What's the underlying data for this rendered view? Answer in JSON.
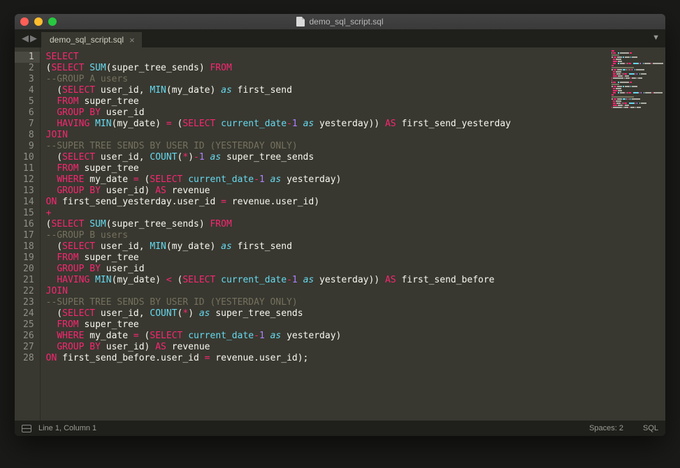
{
  "window_title": "demo_sql_script.sql",
  "tab": {
    "label": "demo_sql_script.sql"
  },
  "status": {
    "position": "Line 1, Column 1",
    "spaces": "Spaces: 2",
    "syntax": "SQL"
  },
  "lines": [
    {
      "n": 1,
      "tokens": [
        [
          "kw",
          "SELECT"
        ]
      ]
    },
    {
      "n": 2,
      "tokens": [
        [
          "ident",
          "("
        ],
        [
          "kw",
          "SELECT"
        ],
        [
          "ident",
          " "
        ],
        [
          "fn",
          "SUM"
        ],
        [
          "ident",
          "(super_tree_sends) "
        ],
        [
          "kw",
          "FROM"
        ]
      ]
    },
    {
      "n": 3,
      "tokens": [
        [
          "cm",
          "--GROUP A users"
        ]
      ]
    },
    {
      "n": 4,
      "tokens": [
        [
          "ident",
          "  ("
        ],
        [
          "kw",
          "SELECT"
        ],
        [
          "ident",
          " user_id, "
        ],
        [
          "fn",
          "MIN"
        ],
        [
          "ident",
          "(my_date) "
        ],
        [
          "as",
          "as"
        ],
        [
          "ident",
          " first_send"
        ]
      ]
    },
    {
      "n": 5,
      "tokens": [
        [
          "ident",
          "  "
        ],
        [
          "kw",
          "FROM"
        ],
        [
          "ident",
          " super_tree"
        ]
      ]
    },
    {
      "n": 6,
      "tokens": [
        [
          "ident",
          "  "
        ],
        [
          "kw",
          "GROUP BY"
        ],
        [
          "ident",
          " user_id"
        ]
      ]
    },
    {
      "n": 7,
      "tokens": [
        [
          "ident",
          "  "
        ],
        [
          "kw",
          "HAVING"
        ],
        [
          "ident",
          " "
        ],
        [
          "fn",
          "MIN"
        ],
        [
          "ident",
          "(my_date) "
        ],
        [
          "op",
          "="
        ],
        [
          "ident",
          " ("
        ],
        [
          "kw",
          "SELECT"
        ],
        [
          "ident",
          " "
        ],
        [
          "fn",
          "current_date"
        ],
        [
          "op",
          "-"
        ],
        [
          "num",
          "1"
        ],
        [
          "ident",
          " "
        ],
        [
          "as",
          "as"
        ],
        [
          "ident",
          " yesterday)) "
        ],
        [
          "kw",
          "AS"
        ],
        [
          "ident",
          " first_send_yesterday"
        ]
      ]
    },
    {
      "n": 8,
      "tokens": [
        [
          "kw",
          "JOIN"
        ]
      ]
    },
    {
      "n": 9,
      "tokens": [
        [
          "cm",
          "--SUPER TREE SENDS BY USER ID (YESTERDAY ONLY)"
        ]
      ]
    },
    {
      "n": 10,
      "tokens": [
        [
          "ident",
          "  ("
        ],
        [
          "kw",
          "SELECT"
        ],
        [
          "ident",
          " user_id, "
        ],
        [
          "fn",
          "COUNT"
        ],
        [
          "ident",
          "("
        ],
        [
          "op",
          "*"
        ],
        [
          "ident",
          ")"
        ],
        [
          "op",
          "-"
        ],
        [
          "num",
          "1"
        ],
        [
          "ident",
          " "
        ],
        [
          "as",
          "as"
        ],
        [
          "ident",
          " super_tree_sends"
        ]
      ]
    },
    {
      "n": 11,
      "tokens": [
        [
          "ident",
          "  "
        ],
        [
          "kw",
          "FROM"
        ],
        [
          "ident",
          " super_tree"
        ]
      ]
    },
    {
      "n": 12,
      "tokens": [
        [
          "ident",
          "  "
        ],
        [
          "kw",
          "WHERE"
        ],
        [
          "ident",
          " my_date "
        ],
        [
          "op",
          "="
        ],
        [
          "ident",
          " ("
        ],
        [
          "kw",
          "SELECT"
        ],
        [
          "ident",
          " "
        ],
        [
          "fn",
          "current_date"
        ],
        [
          "op",
          "-"
        ],
        [
          "num",
          "1"
        ],
        [
          "ident",
          " "
        ],
        [
          "as",
          "as"
        ],
        [
          "ident",
          " yesterday)"
        ]
      ]
    },
    {
      "n": 13,
      "tokens": [
        [
          "ident",
          "  "
        ],
        [
          "kw",
          "GROUP BY"
        ],
        [
          "ident",
          " user_id) "
        ],
        [
          "kw",
          "AS"
        ],
        [
          "ident",
          " revenue"
        ]
      ]
    },
    {
      "n": 14,
      "tokens": [
        [
          "kw",
          "ON"
        ],
        [
          "ident",
          " first_send_yesterday"
        ],
        [
          "ident",
          "."
        ],
        [
          "ident",
          "user_id "
        ],
        [
          "op",
          "="
        ],
        [
          "ident",
          " revenue"
        ],
        [
          "ident",
          "."
        ],
        [
          "ident",
          "user_id)"
        ]
      ]
    },
    {
      "n": 15,
      "tokens": [
        [
          "op",
          "+"
        ]
      ]
    },
    {
      "n": 16,
      "tokens": [
        [
          "ident",
          "("
        ],
        [
          "kw",
          "SELECT"
        ],
        [
          "ident",
          " "
        ],
        [
          "fn",
          "SUM"
        ],
        [
          "ident",
          "(super_tree_sends) "
        ],
        [
          "kw",
          "FROM"
        ]
      ]
    },
    {
      "n": 17,
      "tokens": [
        [
          "cm",
          "--GROUP B users"
        ]
      ]
    },
    {
      "n": 18,
      "tokens": [
        [
          "ident",
          "  ("
        ],
        [
          "kw",
          "SELECT"
        ],
        [
          "ident",
          " user_id, "
        ],
        [
          "fn",
          "MIN"
        ],
        [
          "ident",
          "(my_date) "
        ],
        [
          "as",
          "as"
        ],
        [
          "ident",
          " first_send"
        ]
      ]
    },
    {
      "n": 19,
      "tokens": [
        [
          "ident",
          "  "
        ],
        [
          "kw",
          "FROM"
        ],
        [
          "ident",
          " super_tree"
        ]
      ]
    },
    {
      "n": 20,
      "tokens": [
        [
          "ident",
          "  "
        ],
        [
          "kw",
          "GROUP BY"
        ],
        [
          "ident",
          " user_id"
        ]
      ]
    },
    {
      "n": 21,
      "tokens": [
        [
          "ident",
          "  "
        ],
        [
          "kw",
          "HAVING"
        ],
        [
          "ident",
          " "
        ],
        [
          "fn",
          "MIN"
        ],
        [
          "ident",
          "(my_date) "
        ],
        [
          "op",
          "<"
        ],
        [
          "ident",
          " ("
        ],
        [
          "kw",
          "SELECT"
        ],
        [
          "ident",
          " "
        ],
        [
          "fn",
          "current_date"
        ],
        [
          "op",
          "-"
        ],
        [
          "num",
          "1"
        ],
        [
          "ident",
          " "
        ],
        [
          "as",
          "as"
        ],
        [
          "ident",
          " yesterday)) "
        ],
        [
          "kw",
          "AS"
        ],
        [
          "ident",
          " first_send_before"
        ]
      ]
    },
    {
      "n": 22,
      "tokens": [
        [
          "kw",
          "JOIN"
        ]
      ]
    },
    {
      "n": 23,
      "tokens": [
        [
          "cm",
          "--SUPER TREE SENDS BY USER ID (YESTERDAY ONLY)"
        ]
      ]
    },
    {
      "n": 24,
      "tokens": [
        [
          "ident",
          "  ("
        ],
        [
          "kw",
          "SELECT"
        ],
        [
          "ident",
          " user_id, "
        ],
        [
          "fn",
          "COUNT"
        ],
        [
          "ident",
          "("
        ],
        [
          "op",
          "*"
        ],
        [
          "ident",
          ") "
        ],
        [
          "as",
          "as"
        ],
        [
          "ident",
          " super_tree_sends"
        ]
      ]
    },
    {
      "n": 25,
      "tokens": [
        [
          "ident",
          "  "
        ],
        [
          "kw",
          "FROM"
        ],
        [
          "ident",
          " super_tree"
        ]
      ]
    },
    {
      "n": 26,
      "tokens": [
        [
          "ident",
          "  "
        ],
        [
          "kw",
          "WHERE"
        ],
        [
          "ident",
          " my_date "
        ],
        [
          "op",
          "="
        ],
        [
          "ident",
          " ("
        ],
        [
          "kw",
          "SELECT"
        ],
        [
          "ident",
          " "
        ],
        [
          "fn",
          "current_date"
        ],
        [
          "op",
          "-"
        ],
        [
          "num",
          "1"
        ],
        [
          "ident",
          " "
        ],
        [
          "as",
          "as"
        ],
        [
          "ident",
          " yesterday)"
        ]
      ]
    },
    {
      "n": 27,
      "tokens": [
        [
          "ident",
          "  "
        ],
        [
          "kw",
          "GROUP BY"
        ],
        [
          "ident",
          " user_id) "
        ],
        [
          "kw",
          "AS"
        ],
        [
          "ident",
          " revenue"
        ]
      ]
    },
    {
      "n": 28,
      "tokens": [
        [
          "kw",
          "ON"
        ],
        [
          "ident",
          " first_send_before"
        ],
        [
          "ident",
          "."
        ],
        [
          "ident",
          "user_id "
        ],
        [
          "op",
          "="
        ],
        [
          "ident",
          " revenue"
        ],
        [
          "ident",
          "."
        ],
        [
          "ident",
          "user_id);"
        ]
      ]
    }
  ],
  "minimap_colors": {
    "kw": "#f92672",
    "fn": "#66d9ef",
    "cm": "#75715e",
    "ident": "#aeaea6",
    "op": "#f92672",
    "num": "#ae81ff",
    "as": "#66d9ef"
  }
}
